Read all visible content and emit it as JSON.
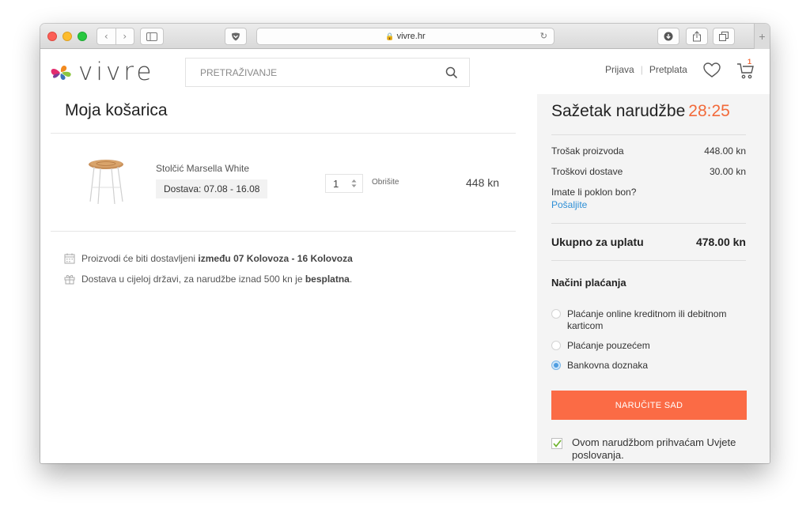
{
  "browser": {
    "url": "vivre.hr"
  },
  "header": {
    "logo_text": "vivre",
    "search_placeholder": "PRETRAŽIVANJE",
    "login": "Prijava",
    "subscribe": "Pretplata",
    "cart_count": "1"
  },
  "cart": {
    "title": "Moja košarica",
    "items": [
      {
        "name": "Stolčić Marsella White",
        "delivery": "Dostava: 07.08 - 16.08",
        "quantity": "1",
        "remove": "Obrišite",
        "price": "448 kn"
      }
    ],
    "info": {
      "delivery_prefix": "Proizvodi će biti dostavljeni",
      "delivery_dates": "između 07 Kolovoza - 16 Kolovoza",
      "shipping_prefix": "Dostava u cijeloj državi, za narudžbe iznad 500 kn je",
      "shipping_free": "besplatna",
      "shipping_suffix": "."
    }
  },
  "summary": {
    "title": "Sažetak narudžbe",
    "timer": "28:25",
    "product_cost_label": "Trošak proizvoda",
    "product_cost_value": "448.00 kn",
    "shipping_cost_label": "Troškovi dostave",
    "shipping_cost_value": "30.00 kn",
    "voucher_question": "Imate li poklon bon?",
    "voucher_link": "Pošaljite",
    "total_label": "Ukupno za uplatu",
    "total_value": "478.00 kn",
    "payment_title": "Načini plaćanja",
    "payment_options": [
      {
        "label": "Plaćanje online kreditnom ili debitnom karticom",
        "selected": false
      },
      {
        "label": "Plaćanje pouzećem",
        "selected": false
      },
      {
        "label": "Bankovna doznaka",
        "selected": true
      }
    ],
    "order_button": "NARUČITE SAD",
    "terms_text": "Ovom narudžbom prihvaćam Uvjete poslovanja.",
    "terms_checked": true
  },
  "colors": {
    "accent": "#fb6b45",
    "timer": "#f26a3a",
    "link": "#2d8fd6"
  },
  "icons": {
    "search": "search-icon",
    "wishlist": "heart-icon",
    "cart": "cart-icon",
    "calendar": "calendar-icon",
    "gift": "gift-icon"
  }
}
